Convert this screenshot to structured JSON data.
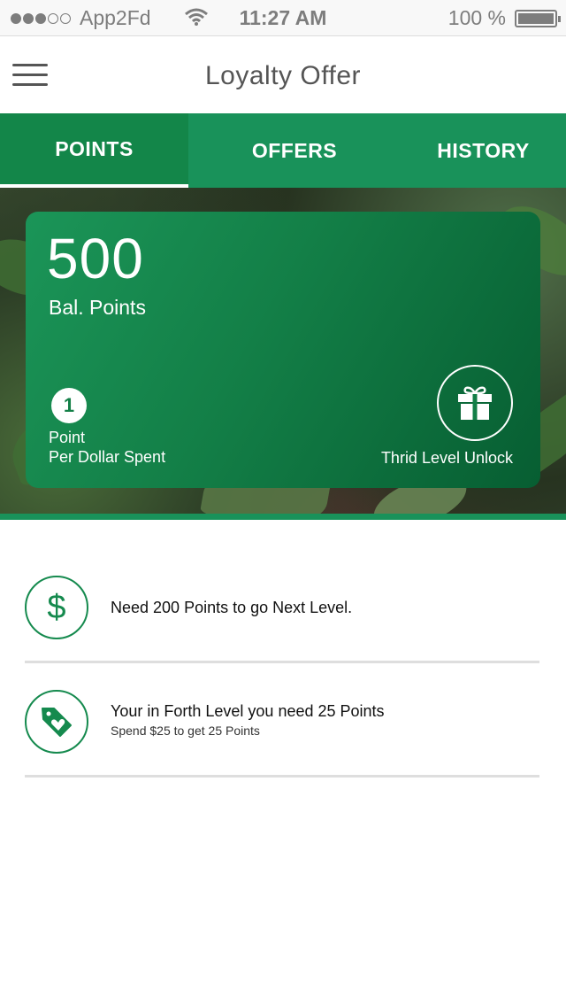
{
  "status_bar": {
    "carrier": "App2Fd",
    "time": "11:27 AM",
    "battery": "100 %"
  },
  "header": {
    "title": "Loyalty Offer"
  },
  "tabs": [
    {
      "label": "POINTS",
      "active": true
    },
    {
      "label": "OFFERS",
      "active": false
    },
    {
      "label": "HISTORY",
      "active": false
    }
  ],
  "points_card": {
    "balance": "500",
    "balance_label": "Bal. Points",
    "rate_value": "1",
    "rate_line1": "Point",
    "rate_line2": "Per Dollar Spent",
    "unlock_label": "Thrid Level Unlock",
    "unlock_icon": "gift-icon"
  },
  "list": [
    {
      "icon": "dollar-icon",
      "title": "Need 200 Points  to go Next Level."
    },
    {
      "icon": "price-tag-heart-icon",
      "title": "Your in Forth Level you need 25 Points",
      "subtitle": "Spend $25 to get 25 Points"
    }
  ],
  "colors": {
    "brand_green": "#19925a",
    "tab_active": "#138649",
    "card_dark": "#075e32"
  }
}
